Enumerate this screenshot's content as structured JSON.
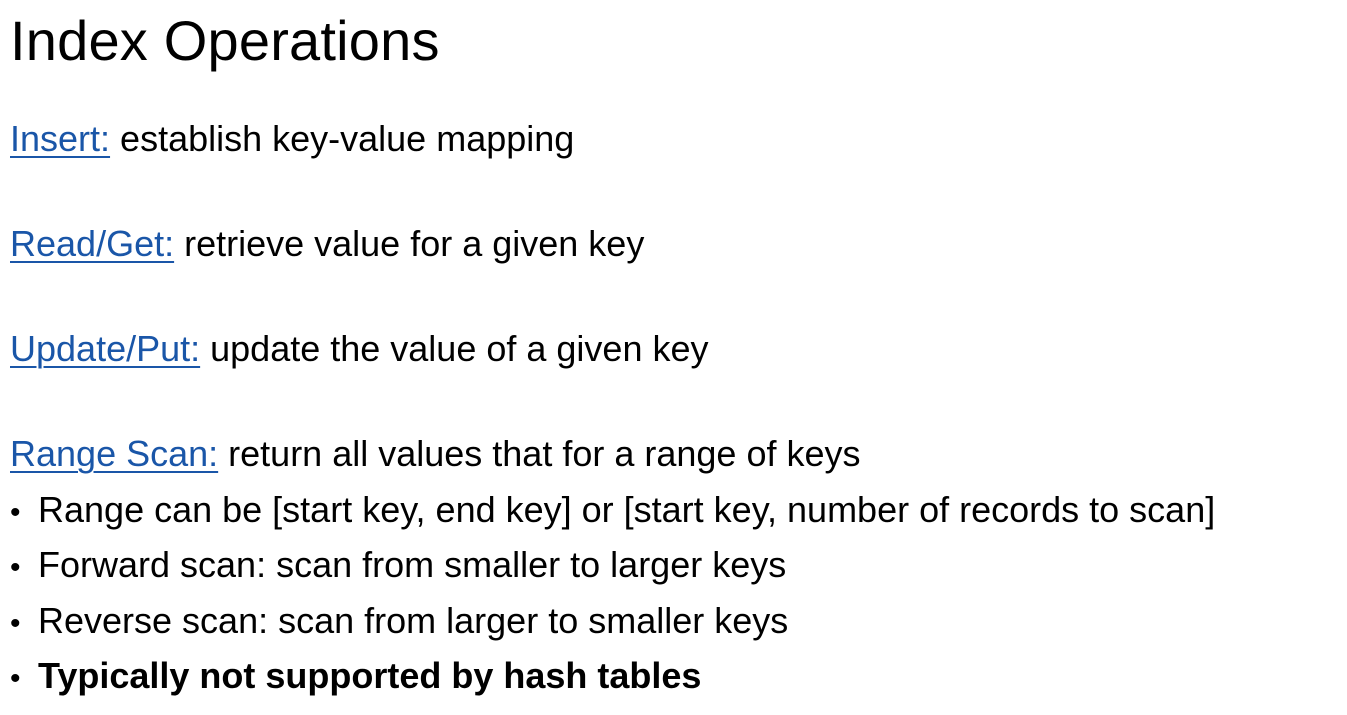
{
  "title": "Index Operations",
  "operations": [
    {
      "name": "Insert:",
      "description": " establish key-value mapping"
    },
    {
      "name": "Read/Get:",
      "description": " retrieve value for a given key"
    },
    {
      "name": "Update/Put:",
      "description": " update the value of a given key"
    },
    {
      "name": "Range Scan:",
      "description": " return all values that for a range of keys"
    }
  ],
  "range_scan_bullets": [
    {
      "marker": "•",
      "text": "Range can be [start key, end key] or [start key, number of records to scan]",
      "bold": false
    },
    {
      "marker": "•",
      "text": "Forward scan: scan from smaller to larger keys",
      "bold": false
    },
    {
      "marker": "•",
      "text": "Reverse scan: scan from larger to smaller keys",
      "bold": false
    },
    {
      "marker": "•",
      "text": "Typically not supported by hash tables",
      "bold": true
    }
  ],
  "colors": {
    "link": "#1a56a8",
    "text": "#000000",
    "background": "#ffffff"
  }
}
